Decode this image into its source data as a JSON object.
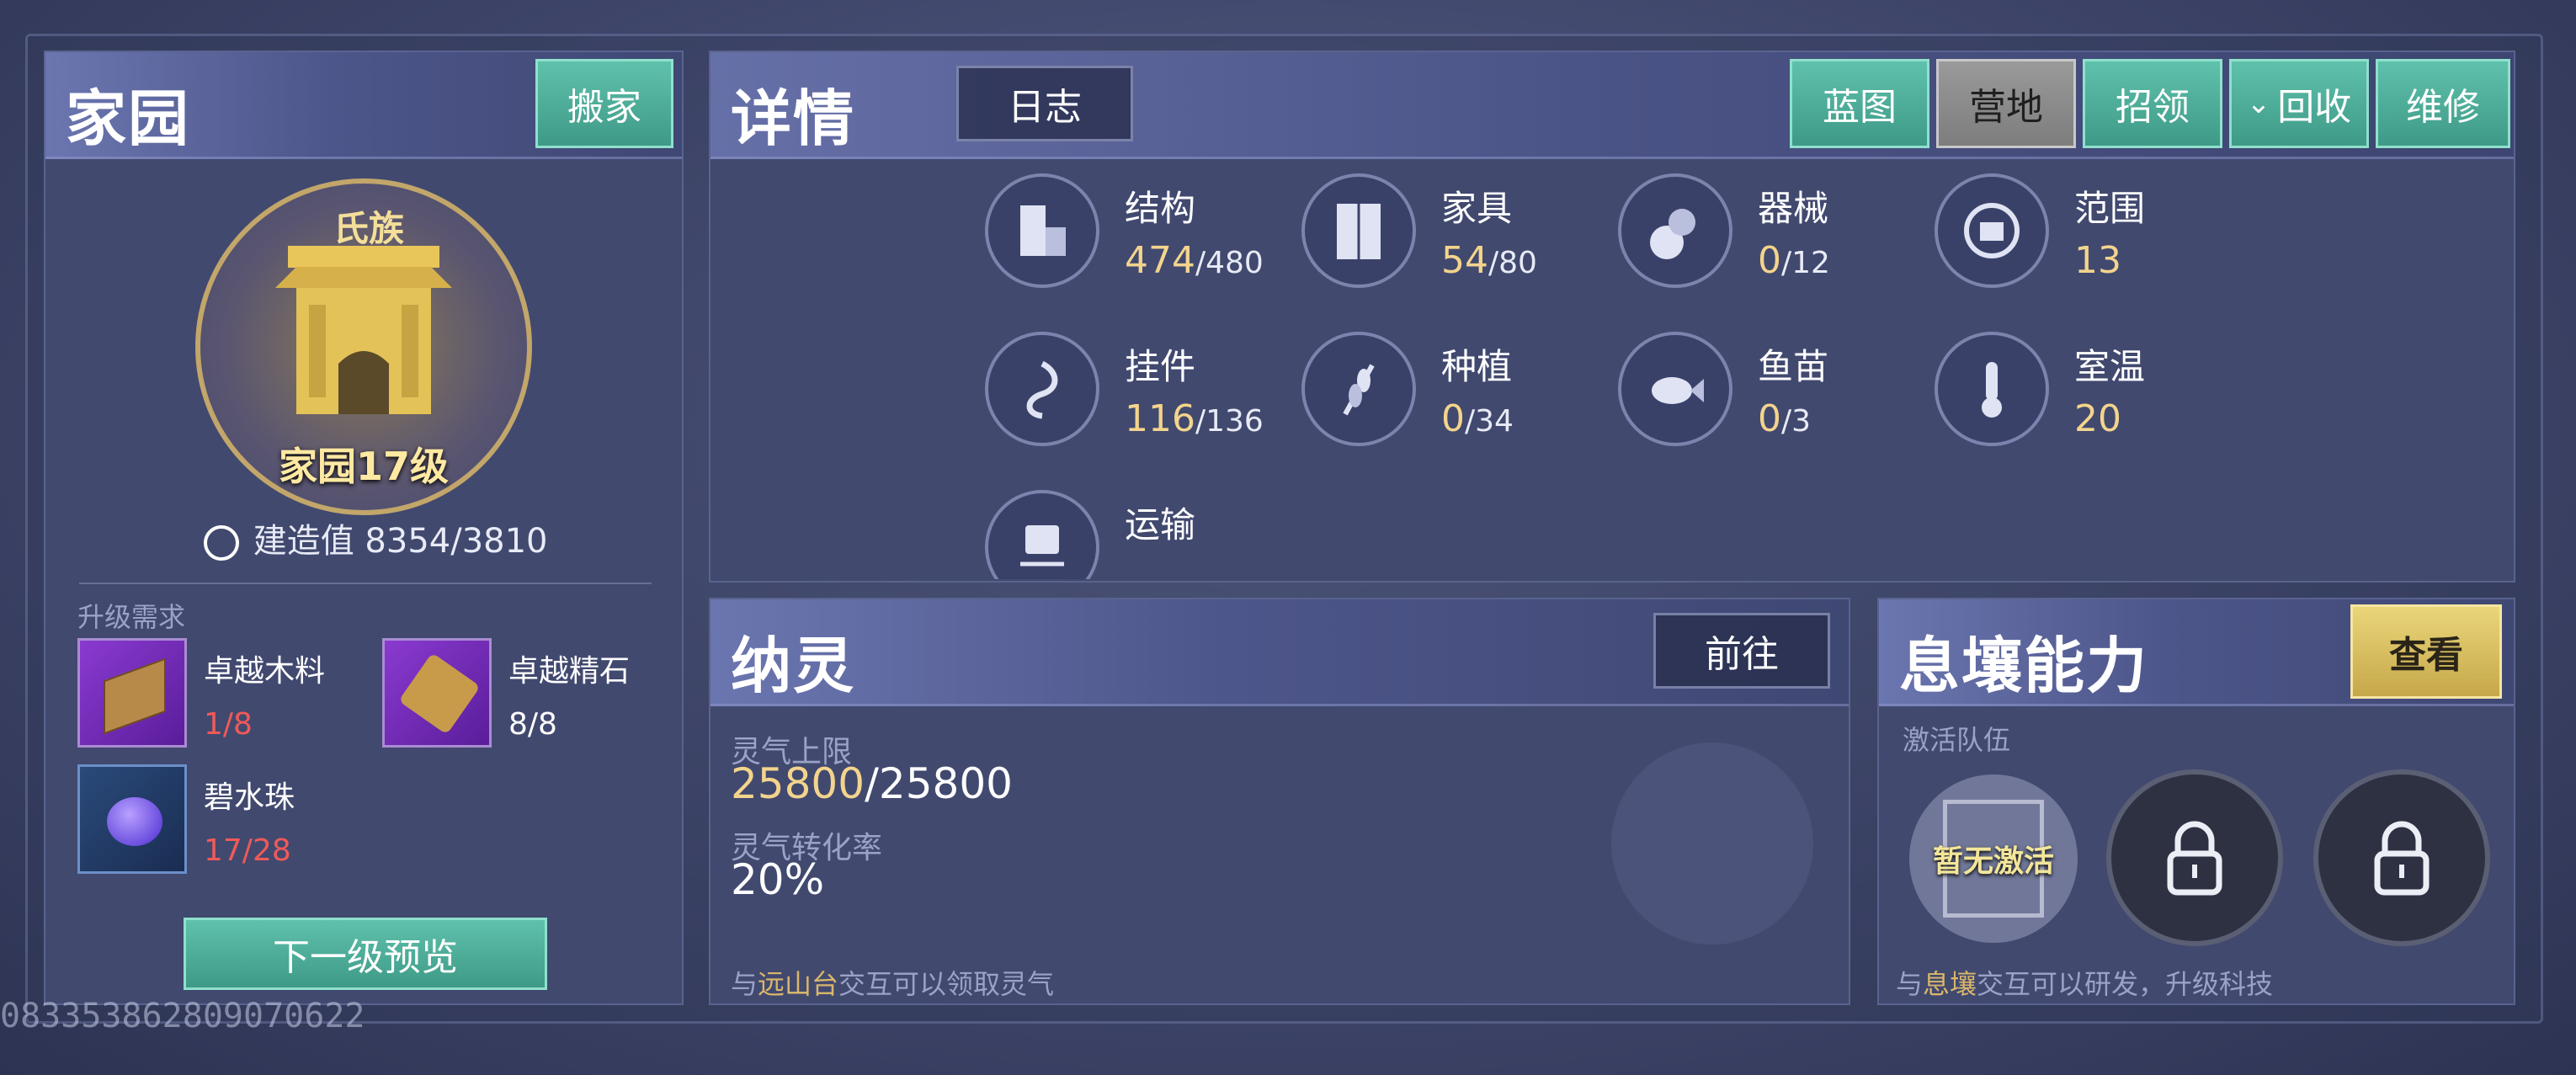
{
  "home": {
    "title": "家园",
    "move_label": "搬家",
    "clan_tag": "氏族",
    "level_label": "家园17级",
    "build_value_label": "建造值 8354/3810",
    "upgrade_requirements_label": "升级需求",
    "materials": [
      {
        "name": "卓越木料",
        "count": "1/8",
        "status": "insufficient"
      },
      {
        "name": "卓越精石",
        "count": "8/8",
        "status": "sufficient"
      },
      {
        "name": "碧水珠",
        "count": "17/28",
        "status": "insufficient"
      }
    ],
    "preview_label": "下一级预览"
  },
  "details": {
    "title": "详情",
    "log_label": "日志",
    "tabs": [
      {
        "label": "蓝图",
        "state": "normal"
      },
      {
        "label": "营地",
        "state": "selected"
      },
      {
        "label": "招领",
        "state": "normal"
      },
      {
        "label": "回收",
        "state": "normal"
      },
      {
        "label": "维修",
        "state": "normal"
      }
    ],
    "stats": [
      {
        "name": "结构",
        "value": "474",
        "max": "/480"
      },
      {
        "name": "家具",
        "value": "54",
        "max": "/80"
      },
      {
        "name": "器械",
        "value": "0",
        "max": "/12"
      },
      {
        "name": "范围",
        "value": "13",
        "max": ""
      },
      {
        "name": "挂件",
        "value": "116",
        "max": "/136"
      },
      {
        "name": "种植",
        "value": "0",
        "max": "/34"
      },
      {
        "name": "鱼苗",
        "value": "0",
        "max": "/3"
      },
      {
        "name": "室温",
        "value": "20",
        "max": ""
      },
      {
        "name": "运输",
        "value": "",
        "max": ""
      }
    ]
  },
  "naling": {
    "title": "纳灵",
    "goto_label": "前往",
    "cap_label": "灵气上限",
    "cap_current": "25800",
    "cap_max": "/25800",
    "rate_label": "灵气转化率",
    "rate_value": "20%",
    "hint_prefix": "与",
    "hint_place": "远山台",
    "hint_suffix": "交互可以领取灵气"
  },
  "xirang": {
    "title": "息壤能力",
    "view_label": "查看",
    "team_label": "激活队伍",
    "slot_text": "暂无激活",
    "hint_prefix": "与",
    "hint_place": "息壤",
    "hint_suffix": "交互可以研发，升级科技"
  },
  "watermark": "0833538628090706​22"
}
